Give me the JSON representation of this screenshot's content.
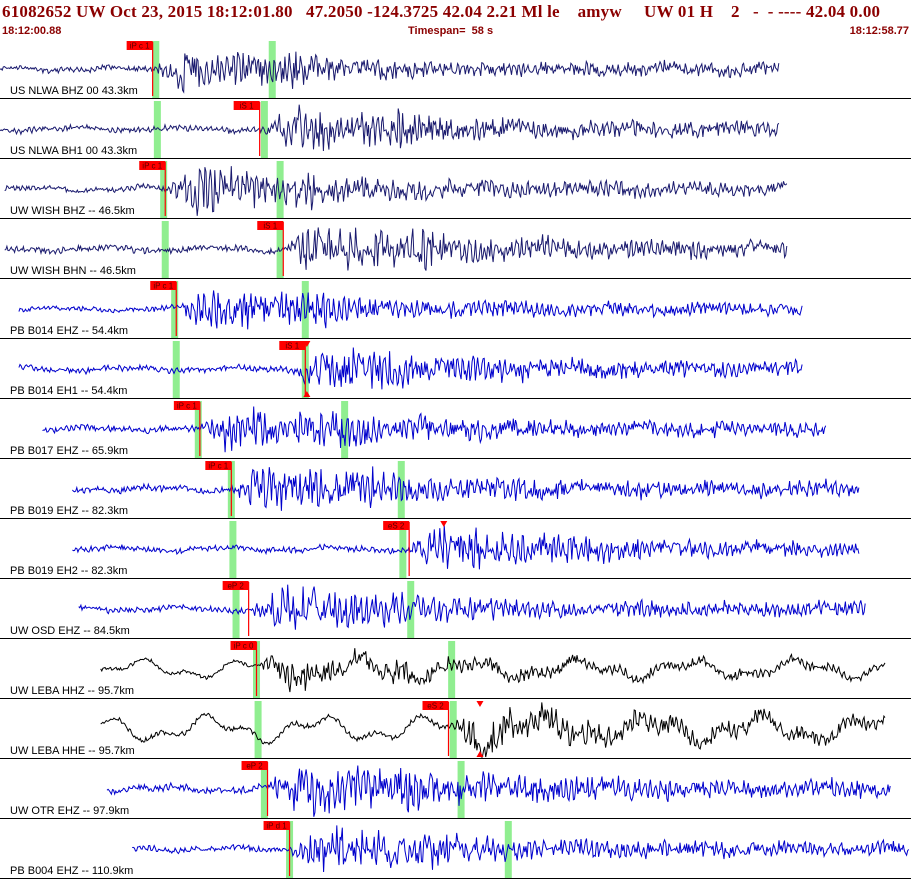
{
  "header": {
    "title": "61082652 UW Oct 23, 2015 18:12:01.80   47.2050 -124.3725 42.04 2.21 Ml le    amyw     UW 01 H    2   -  - ---- 42.04 0.00",
    "start_time": "18:12:00.88",
    "timespan_label": "Timespan=  58 s",
    "end_time": "18:12:58.77"
  },
  "colors": {
    "title_text": "#8b0000",
    "pick_box": "#ff0000",
    "pick_line": "#ff0000",
    "window_band": "#90ee90",
    "trace_navy": "#1a1a6e",
    "trace_blue": "#0000cc",
    "trace_black": "#000000",
    "separator": "#000000"
  },
  "chart_data": {
    "type": "seismogram",
    "time_start": 0.0,
    "time_end": 57.89,
    "traces": [
      {
        "label": "US NLWA BHZ 00 43.3km",
        "color": "navy",
        "data_start": 0.0,
        "data_end": 49.5,
        "amp": 0.55,
        "picks": [
          {
            "text": "iP c 1",
            "t": 9.7
          }
        ],
        "windows": [
          9.9,
          17.3
        ],
        "triangles": []
      },
      {
        "label": "US NLWA BH1 00 43.3km",
        "color": "navy",
        "data_start": 0.0,
        "data_end": 49.5,
        "amp": 0.6,
        "picks": [
          {
            "text": "iS 1",
            "t": 16.5
          }
        ],
        "windows": [
          10.0,
          16.8
        ],
        "triangles": []
      },
      {
        "label": "UW WISH BHZ -- 46.5km",
        "color": "navy",
        "data_start": 0.3,
        "data_end": 50.0,
        "amp": 0.6,
        "picks": [
          {
            "text": "iP c 1",
            "t": 10.5
          }
        ],
        "windows": [
          10.4,
          17.8
        ],
        "triangles": []
      },
      {
        "label": "UW WISH BHN -- 46.5km",
        "color": "navy",
        "data_start": 0.3,
        "data_end": 50.0,
        "amp": 0.65,
        "picks": [
          {
            "text": "iS 1",
            "t": 18.0
          }
        ],
        "windows": [
          10.5,
          17.8
        ],
        "triangles": []
      },
      {
        "label": "PB B014 EHZ -- 54.4km",
        "color": "blue",
        "data_start": 1.2,
        "data_end": 51.0,
        "amp": 0.55,
        "picks": [
          {
            "text": "iP c 1",
            "t": 11.2
          }
        ],
        "windows": [
          11.1,
          19.4
        ],
        "triangles": []
      },
      {
        "label": "PB B014 EH1 -- 54.4km",
        "color": "blue",
        "data_start": 1.2,
        "data_end": 51.0,
        "amp": 0.6,
        "picks": [
          {
            "text": "iS 1",
            "t": 19.4
          }
        ],
        "windows": [
          11.2,
          19.4
        ],
        "triangles": [
          {
            "t": 19.5,
            "dir": "down",
            "at": "top"
          },
          {
            "t": 19.5,
            "dir": "up",
            "at": "bottom"
          }
        ]
      },
      {
        "label": "PB B017 EHZ -- 65.9km",
        "color": "blue",
        "data_start": 2.7,
        "data_end": 52.5,
        "amp": 0.65,
        "picks": [
          {
            "text": "iP c 1",
            "t": 12.7
          }
        ],
        "windows": [
          12.6,
          21.9
        ],
        "triangles": []
      },
      {
        "label": "PB B019 EHZ -- 82.3km",
        "color": "blue",
        "data_start": 4.6,
        "data_end": 54.6,
        "amp": 0.65,
        "picks": [
          {
            "text": "iP c 1",
            "t": 14.7
          }
        ],
        "windows": [
          14.7,
          25.5
        ],
        "triangles": []
      },
      {
        "label": "PB B019 EH2 -- 82.3km",
        "color": "blue",
        "data_start": 4.6,
        "data_end": 54.6,
        "amp": 0.6,
        "picks": [
          {
            "text": "eS 2",
            "t": 26.0
          }
        ],
        "windows": [
          14.8,
          25.6
        ],
        "triangles": [
          {
            "t": 28.2,
            "dir": "down",
            "at": "top"
          }
        ]
      },
      {
        "label": "UW OSD EHZ -- 84.5km",
        "color": "blue",
        "data_start": 5.0,
        "data_end": 55.0,
        "amp": 0.6,
        "picks": [
          {
            "text": "eP 2",
            "t": 15.8
          }
        ],
        "windows": [
          15.0,
          26.1
        ],
        "triangles": []
      },
      {
        "label": "UW LEBA HHZ -- 95.7km",
        "color": "black",
        "data_start": 6.4,
        "data_end": 56.3,
        "amp": 0.55,
        "picks": [
          {
            "text": "iP c 0",
            "t": 16.3
          }
        ],
        "windows": [
          16.3,
          28.7
        ],
        "triangles": []
      },
      {
        "label": "UW LEBA HHE -- 95.7km",
        "color": "black",
        "data_start": 6.4,
        "data_end": 56.3,
        "amp": 0.75,
        "picks": [
          {
            "text": "eS 2",
            "t": 28.5
          }
        ],
        "windows": [
          16.4,
          28.8
        ],
        "triangles": [
          {
            "t": 30.5,
            "dir": "down",
            "at": "top"
          },
          {
            "t": 30.5,
            "dir": "up",
            "at": "bottom"
          }
        ]
      },
      {
        "label": "UW OTR EHZ -- 97.9km",
        "color": "blue",
        "data_start": 6.8,
        "data_end": 56.6,
        "amp": 0.75,
        "picks": [
          {
            "text": "eP 2",
            "t": 17.0
          }
        ],
        "windows": [
          16.8,
          29.3
        ],
        "triangles": []
      },
      {
        "label": "PB B004 EHZ -- 110.9km",
        "color": "blue",
        "data_start": 8.4,
        "data_end": 57.89,
        "amp": 0.6,
        "picks": [
          {
            "text": "iP d 1",
            "t": 18.4
          }
        ],
        "windows": [
          18.4,
          32.3
        ],
        "triangles": []
      }
    ]
  }
}
